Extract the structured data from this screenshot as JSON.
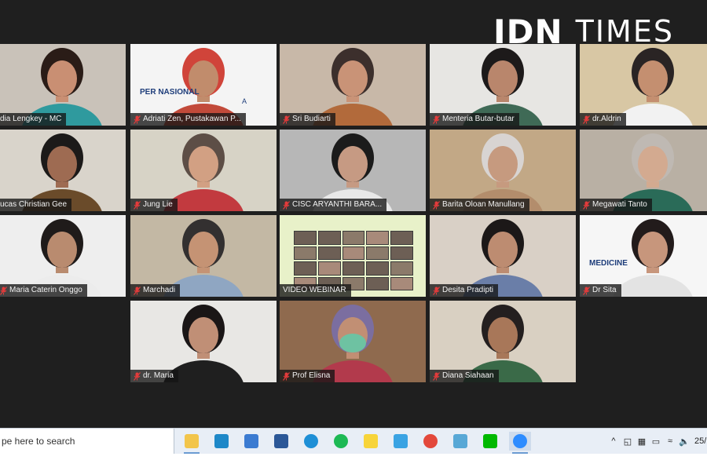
{
  "watermark": {
    "brand_part1": "IDN",
    "brand_part2": "TIMES"
  },
  "tiles": [
    {
      "name": "dia-lengkey",
      "label": "dia Lengkey - MC",
      "mic": false,
      "bg": "#c9c2b9",
      "skin": "#c98f73",
      "hair": "#2a1c17",
      "shirt": "#2f9a9e"
    },
    {
      "name": "adriati-zen",
      "label": "Adriati Zen, Pustakawan P...",
      "mic": true,
      "bg": "#f4f4f4",
      "skin": "#c18c6c",
      "hair": "#d0443a",
      "shirt": "#c24a3a",
      "overlay_text": "PER       NASIONAL",
      "overlay_text2": "A"
    },
    {
      "name": "sri-budiarti",
      "label": "Sri Budiarti",
      "mic": true,
      "bg": "#c8b8a8",
      "skin": "#c99377",
      "hair": "#3c2f2c",
      "shirt": "#b26a3b"
    },
    {
      "name": "menteria",
      "label": "Menteria Butar-butar",
      "mic": true,
      "bg": "#e7e6e3",
      "skin": "#b9866c",
      "hair": "#1d1a1a",
      "shirt": "#3f6a56"
    },
    {
      "name": "dr-aldrin",
      "label": "dr.Aldrin",
      "mic": true,
      "bg": "#d8c7a4",
      "skin": "#c48f70",
      "hair": "#2a2424",
      "shirt": "#f2f2f2"
    },
    {
      "name": "lucas",
      "label": "ucas Christian Gee",
      "mic": false,
      "bg": "#d9d4cb",
      "skin": "#9e6b52",
      "hair": "#1c1a19",
      "shirt": "#6a4b2a"
    },
    {
      "name": "jung-lie",
      "label": "Jung Lie",
      "mic": true,
      "bg": "#d7d3c6",
      "skin": "#d2a083",
      "hair": "#5d4e46",
      "shirt": "#c23a3f"
    },
    {
      "name": "cisc-aryanthi",
      "label": "CISC ARYANTHI BARA...",
      "mic": true,
      "bg": "#b7b7b7",
      "skin": "#c69a83",
      "hair": "#1b1b1b",
      "shirt": "#e8e8e8"
    },
    {
      "name": "barita-oloan",
      "label": "Barita Oloan Manullang",
      "mic": true,
      "bg": "#c2a886",
      "skin": "#c69a7f",
      "hair": "#d8d4d2",
      "shirt": "#b38d6c"
    },
    {
      "name": "megawati-tanto",
      "label": "Megawati Tanto",
      "mic": true,
      "bg": "#b9b0a4",
      "skin": "#d3aa90",
      "hair": "#bfb9b3",
      "shirt": "#2a6b58"
    },
    {
      "name": "maria-caterin",
      "label": "Maria Caterin Onggo",
      "mic": true,
      "bg": "#eeeeee",
      "skin": "#b98b6f",
      "hair": "#1f1b1a",
      "shirt": "#ececec"
    },
    {
      "name": "marchadi",
      "label": "Marchadi",
      "mic": true,
      "bg": "#c3b8a4",
      "skin": "#c59374",
      "hair": "#333030",
      "shirt": "#8fa6c2"
    },
    {
      "name": "video-webinar",
      "label": "VIDEO WEBINAR",
      "mic": false,
      "bg": "#e8f1c9",
      "skin": "#b08770",
      "hair": "#2b2020",
      "shirt": "#6a5c52"
    },
    {
      "name": "desita-pradipti",
      "label": "Desita Pradipti",
      "mic": true,
      "bg": "#d9d0c6",
      "skin": "#bd8c71",
      "hair": "#1c1818",
      "shirt": "#6a7ea8"
    },
    {
      "name": "dr-sita",
      "label": "Dr Sita",
      "mic": true,
      "bg": "#f6f6f6",
      "skin": "#c7967c",
      "hair": "#221b1b",
      "shirt": "#e3e3e3",
      "overlay_text": "MEDICINE"
    },
    {
      "name": "dr-maria",
      "label": "dr. Maria",
      "mic": true,
      "bg": "#e8e7e4",
      "skin": "#c08f76",
      "hair": "#1a1616",
      "shirt": "#1f1f1f"
    },
    {
      "name": "prof-elisna",
      "label": "Prof Elisna",
      "mic": true,
      "bg": "#8f6a4e",
      "skin": "#c18f74",
      "hair": "#7b6ea0",
      "shirt": "#b23a4c",
      "mask": "#6ec2a2"
    },
    {
      "name": "diana-siahaan",
      "label": "Diana Siahaan",
      "mic": true,
      "bg": "#d9d0c2",
      "skin": "#a87759",
      "hair": "#241f1f",
      "shirt": "#3a6a48"
    }
  ],
  "taskbar": {
    "search_placeholder": "pe here to search",
    "icons": [
      "file-explorer",
      "l-app",
      "store",
      "word",
      "edge",
      "spotify",
      "sticky-notes",
      "paint",
      "chrome",
      "3d-viewer",
      "line",
      "zoom"
    ],
    "icon_colors": [
      "#f2c54b",
      "#1e88c8",
      "#3b7bd1",
      "#2b5797",
      "#1e8fd6",
      "#1db954",
      "#f7d43a",
      "#3aa3e3",
      "#e3483b",
      "#58a8d6",
      "#00b900",
      "#2d8cff"
    ],
    "clock_partial": "25/"
  }
}
